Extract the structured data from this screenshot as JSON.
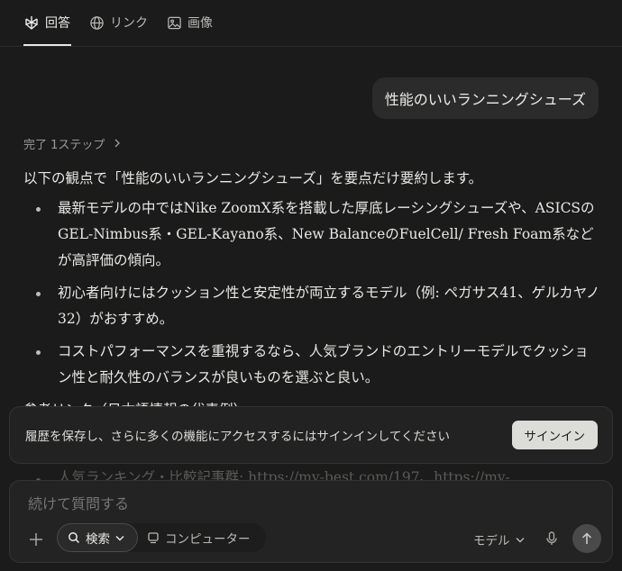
{
  "tabs": [
    {
      "label": "回答",
      "icon": "perplexity-logo-icon",
      "active": true
    },
    {
      "label": "リンク",
      "icon": "globe-icon",
      "active": false
    },
    {
      "label": "画像",
      "icon": "image-icon",
      "active": false
    }
  ],
  "user_query": "性能のいいランニングシューズ",
  "steps": {
    "label": "完了 1ステップ",
    "icon": "chevron-right-icon"
  },
  "answer": {
    "intro": "以下の観点で「性能のいいランニングシューズ」を要点だけ要約します。",
    "bullets": [
      "最新モデルの中ではNike ZoomX系を搭載した厚底レーシングシューズや、ASICSのGEL-Nimbus系・GEL-Kayano系、New BalanceのFuelCell/ Fresh Foam系などが高評価の傾向。",
      "初心者向けにはクッション性と安定性が両立するモデル（例: ペガサス41、ゲルカヤノ32）がおすすめ。",
      "コストパフォーマンスを重視するなら、人気ブランドのエントリーモデルでクッション性と耐久性のバランスが良いものを選ぶと良い。"
    ],
    "ref_heading": "参考リンク（日本語情報の代表例）",
    "faded_item": "人気ランキング・比較記事群: https://my-best.com/197、https://my-"
  },
  "signin_banner": {
    "text": "履歴を保存し、さらに多くの機能にアクセスするにはサインインしてください",
    "button": "サインイン"
  },
  "composer": {
    "placeholder": "続けて質問する",
    "search_mode": "検索",
    "computer_mode": "コンピューター",
    "model_label": "モデル"
  },
  "colors": {
    "background": "#1b1b1b",
    "bubble": "#2b2b2b",
    "banner": "#222222",
    "button": "#dcdcd8"
  }
}
